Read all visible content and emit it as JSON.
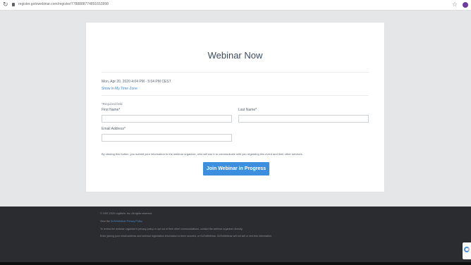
{
  "browser": {
    "url": "register.gotowebinar.com/register/7788888774891653998",
    "icons": {
      "reload": "reload-icon",
      "lock": "lock-icon",
      "star": "star-icon",
      "profile": "profile-avatar"
    }
  },
  "page": {
    "title": "Webinar Now",
    "datetime": "Mon, Apr 20, 2020 4:04 PM - 5:04 PM CEST",
    "timezone_link": "Show in My Time Zone",
    "required_note": "*Required field",
    "fields": {
      "first_name": {
        "label": "First Name*",
        "value": "",
        "placeholder": ""
      },
      "last_name": {
        "label": "Last Name*",
        "value": "",
        "placeholder": ""
      },
      "email": {
        "label": "Email Address*",
        "value": "",
        "placeholder": ""
      }
    },
    "consent": "By clicking this button, you submit your information to the webinar organizer, who will use it to communicate with you regarding this event and their other services.",
    "join_button": "Join Webinar in Progress"
  },
  "footer": {
    "copyright": "© 1997-2020 LogMeIn, Inc. All rights reserved.",
    "privacy_prefix": "View the",
    "privacy_link": "GoToWebinar Privacy Policy",
    "organizer_text": "To review the webinar organizer's privacy policy or opt out of their other communications, contact the webinar organizer directly.",
    "email_notice": "Enter joining your email address and webinar registration information is been secured, or GoToWebinar. GoToWebinar will not sell or rent this information."
  },
  "colors": {
    "background": "#e5e6e8",
    "card": "#ffffff",
    "title": "#3d4b5c",
    "link": "#3a88d6",
    "button": "#3c8fdf",
    "footer": "#2b2c30"
  }
}
